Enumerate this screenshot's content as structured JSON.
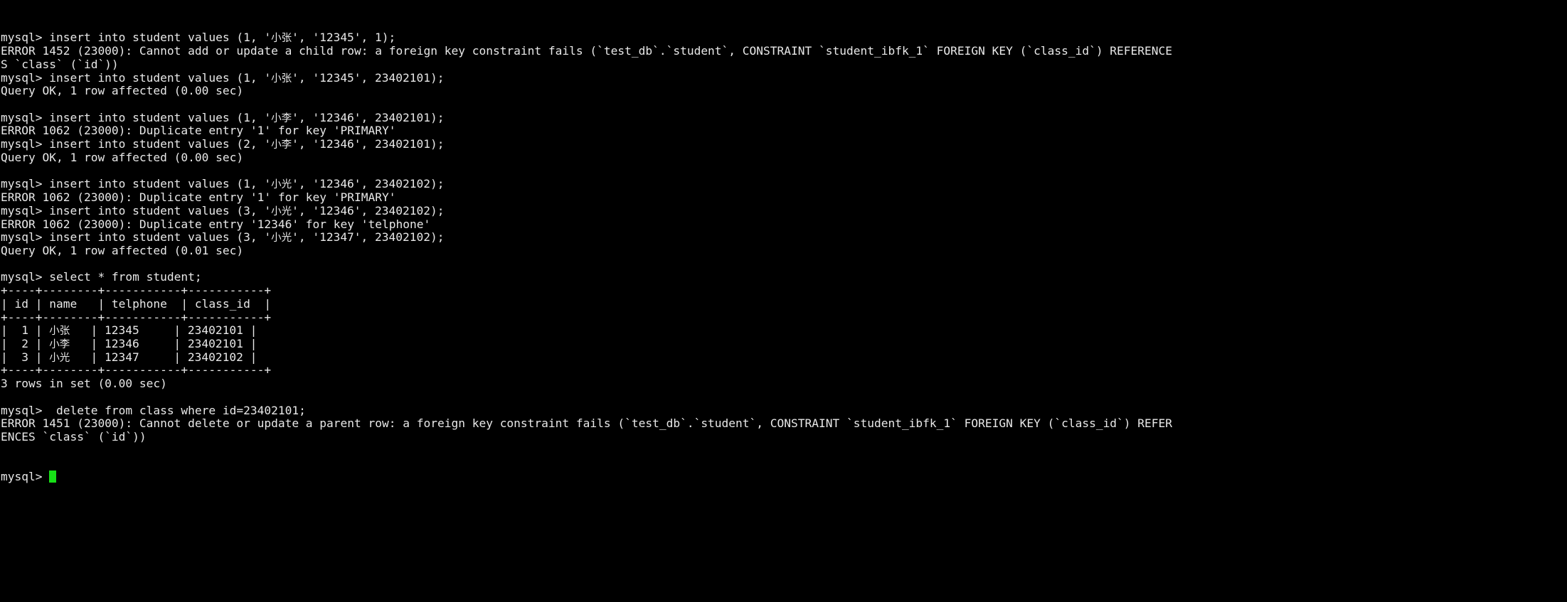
{
  "terminal": {
    "title": "mysql-client-terminal",
    "background_color": "#000000",
    "foreground_color": "#e8e8e8",
    "cursor_color": "#17e017",
    "prompt": "mysql>",
    "cursor_char": "block",
    "lines": [
      "mysql> insert into student values (1, '小张', '12345', 1);",
      "ERROR 1452 (23000): Cannot add or update a child row: a foreign key constraint fails (`test_db`.`student`, CONSTRAINT `student_ibfk_1` FOREIGN KEY (`class_id`) REFERENCE",
      "S `class` (`id`))",
      "mysql> insert into student values (1, '小张', '12345', 23402101);",
      "Query OK, 1 row affected (0.00 sec)",
      "",
      "mysql> insert into student values (1, '小李', '12346', 23402101);",
      "ERROR 1062 (23000): Duplicate entry '1' for key 'PRIMARY'",
      "mysql> insert into student values (2, '小李', '12346', 23402101);",
      "Query OK, 1 row affected (0.00 sec)",
      "",
      "mysql> insert into student values (1, '小光', '12346', 23402102);",
      "ERROR 1062 (23000): Duplicate entry '1' for key 'PRIMARY'",
      "mysql> insert into student values (3, '小光', '12346', 23402102);",
      "ERROR 1062 (23000): Duplicate entry '12346' for key 'telphone'",
      "mysql> insert into student values (3, '小光', '12347', 23402102);",
      "Query OK, 1 row affected (0.01 sec)",
      "",
      "mysql> select * from student;",
      "+----+--------+-----------+-----------+",
      "| id | name   | telphone  | class_id  |",
      "+----+--------+-----------+-----------+",
      "|  1 | 小张   | 12345     | 23402101 |",
      "|  2 | 小李   | 12346     | 23402101 |",
      "|  3 | 小光   | 12347     | 23402102 |",
      "+----+--------+-----------+-----------+",
      "3 rows in set (0.00 sec)",
      "",
      "mysql>  delete from class where id=23402101;",
      "ERROR 1451 (23000): Cannot delete or update a parent row: a foreign key constraint fails (`test_db`.`student`, CONSTRAINT `student_ibfk_1` FOREIGN KEY (`class_id`) REFER",
      "ENCES `class` (`id`))"
    ],
    "final_prompt": "mysql> ",
    "result_table": {
      "columns": [
        "id",
        "name",
        "telphone",
        "class_id"
      ],
      "rows": [
        [
          "1",
          "小张",
          "12345",
          "23402101"
        ],
        [
          "2",
          "小李",
          "12346",
          "23402101"
        ],
        [
          "3",
          "小光",
          "12347",
          "23402102"
        ]
      ],
      "row_count_text": "3 rows in set (0.00 sec)"
    },
    "errors": [
      {
        "code": "ERROR 1452",
        "sqlstate": "23000",
        "message": "Cannot add or update a child row: a foreign key constraint fails (`test_db`.`student`, CONSTRAINT `student_ibfk_1` FOREIGN KEY (`class_id`) REFERENCES `class` (`id`))"
      },
      {
        "code": "ERROR 1062",
        "sqlstate": "23000",
        "message": "Duplicate entry '1' for key 'PRIMARY'"
      },
      {
        "code": "ERROR 1062",
        "sqlstate": "23000",
        "message": "Duplicate entry '12346' for key 'telphone'"
      },
      {
        "code": "ERROR 1451",
        "sqlstate": "23000",
        "message": "Cannot delete or update a parent row: a foreign key constraint fails (`test_db`.`student`, CONSTRAINT `student_ibfk_1` FOREIGN KEY (`class_id`) REFERENCES `class` (`id`))"
      }
    ],
    "success_messages": [
      "Query OK, 1 row affected (0.00 sec)",
      "Query OK, 1 row affected (0.00 sec)",
      "Query OK, 1 row affected (0.01 sec)"
    ]
  }
}
